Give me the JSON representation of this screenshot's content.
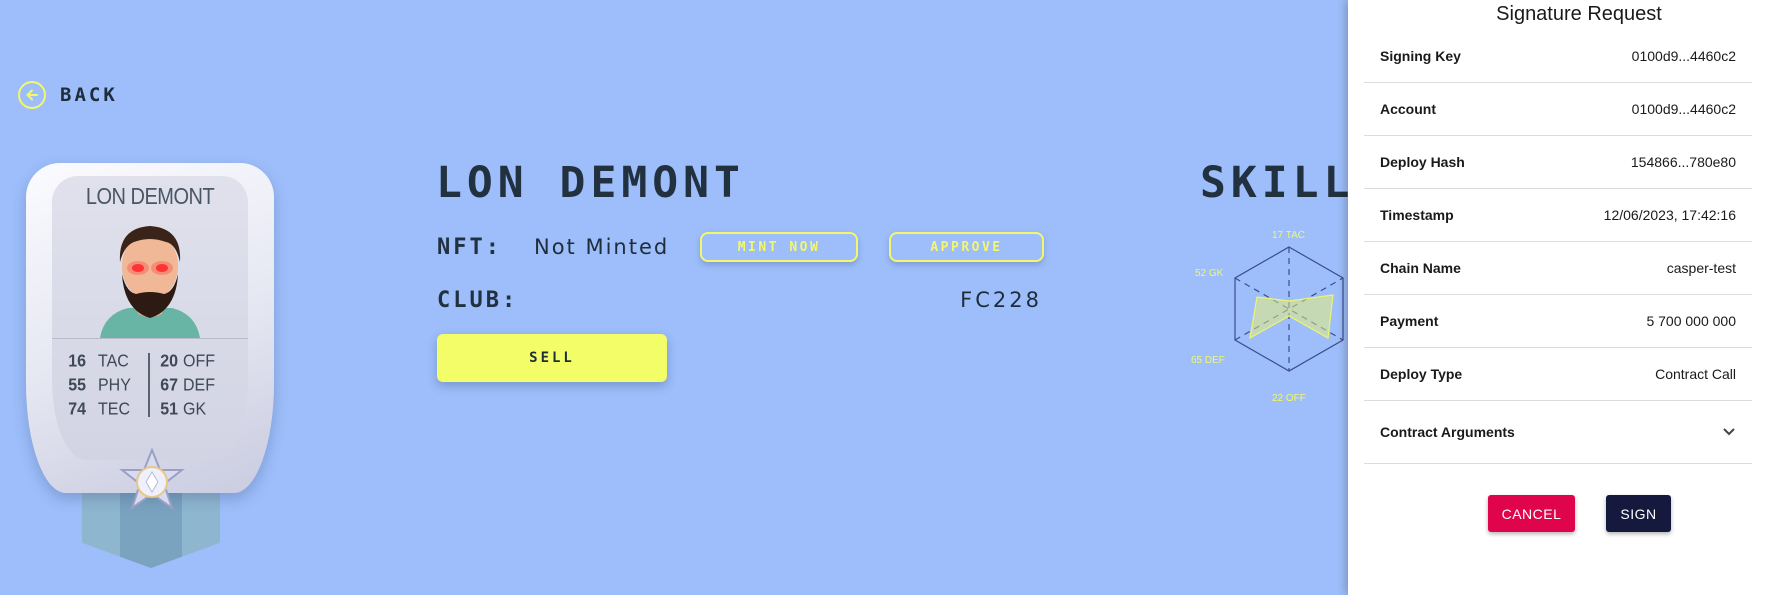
{
  "back": {
    "label": "BACK",
    "icon": "arrow-left-circle-icon"
  },
  "card": {
    "name": "LON DEMONT",
    "stats": [
      {
        "value": "16",
        "label": "TAC"
      },
      {
        "value": "55",
        "label": "PHY"
      },
      {
        "value": "74",
        "label": "TEC"
      },
      {
        "value": "20",
        "label": "OFF"
      },
      {
        "value": "67",
        "label": "DEF"
      },
      {
        "value": "51",
        "label": "GK"
      }
    ]
  },
  "player": {
    "title": "LON DEMONT",
    "nft_label": "NFT:",
    "nft_status": "Not Minted",
    "mint_label": "MINT NOW",
    "approve_label": "APPROVE",
    "club_label": "CLUB:",
    "club_value": "FC228",
    "sell_label": "SELL"
  },
  "skills": {
    "title": "SKILLS",
    "labels": {
      "top": "17 TAC",
      "upper_left": "52 GK",
      "lower_left": "65 DEF",
      "bottom": "22 OFF"
    }
  },
  "signature": {
    "title": "Signature Request",
    "rows": [
      {
        "key": "Signing Key",
        "value": "0100d9...4460c2"
      },
      {
        "key": "Account",
        "value": "0100d9...4460c2"
      },
      {
        "key": "Deploy Hash",
        "value": "154866...780e80"
      },
      {
        "key": "Timestamp",
        "value": "12/06/2023, 17:42:16"
      },
      {
        "key": "Chain Name",
        "value": "casper-test"
      },
      {
        "key": "Payment",
        "value": "5 700 000 000"
      },
      {
        "key": "Deploy Type",
        "value": "Contract Call"
      }
    ],
    "contract_args_label": "Contract Arguments",
    "cancel_label": "CANCEL",
    "sign_label": "SIGN"
  },
  "colors": {
    "background": "#9dbefa",
    "accent_yellow": "#f3f76b",
    "cancel_red": "#e0044c",
    "sign_navy": "#16193e"
  }
}
